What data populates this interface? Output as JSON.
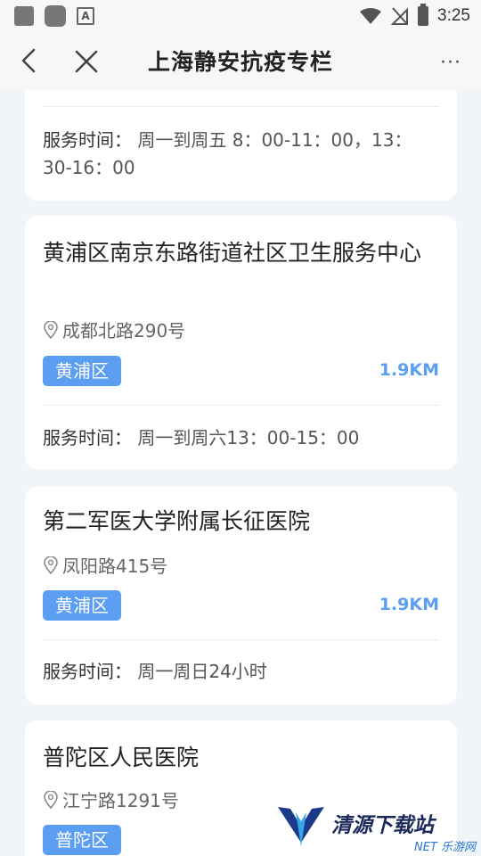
{
  "status_bar": {
    "time": "3:25"
  },
  "nav": {
    "title": "上海静安抗疫专栏",
    "more": "···"
  },
  "cards": [
    {
      "hours_label": "服务时间：",
      "hours_value": "周一到周五 8：00-11：00，13：30-16：00"
    },
    {
      "name": "黄浦区南京东路街道社区卫生服务中心",
      "address": "成都北路290号",
      "district": "黄浦区",
      "distance": "1.9KM",
      "hours_label": "服务时间：",
      "hours_value": "周一到周六13：00-15：00"
    },
    {
      "name": "第二军医大学附属长征医院",
      "address": "凤阳路415号",
      "district": "黄浦区",
      "distance": "1.9KM",
      "hours_label": "服务时间：",
      "hours_value": "周一周日24小时"
    },
    {
      "name": "普陀区人民医院",
      "address": "江宁路1291号",
      "district": "普陀区"
    }
  ],
  "watermark": {
    "text": "清源下载站",
    "sub": "NET 乐游网"
  }
}
